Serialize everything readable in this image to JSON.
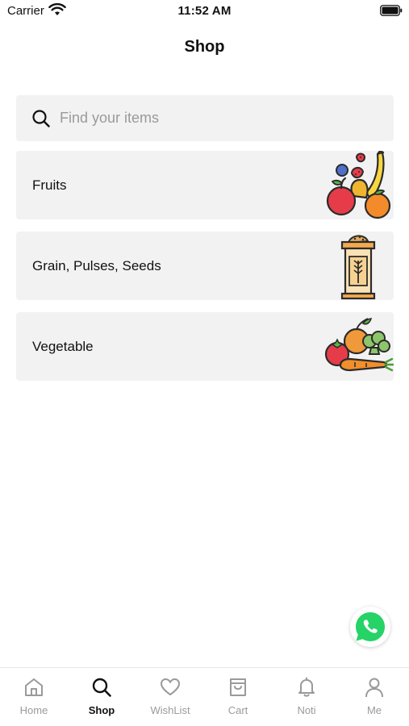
{
  "status_bar": {
    "carrier": "Carrier",
    "time": "11:52 AM"
  },
  "header": {
    "title": "Shop"
  },
  "search": {
    "placeholder": "Find your items"
  },
  "categories": [
    {
      "label": "Fruits",
      "icon": "fruits-illustration"
    },
    {
      "label": "Grain, Pulses, Seeds",
      "icon": "grain-sack-illustration"
    },
    {
      "label": "Vegetable",
      "icon": "vegetables-illustration"
    }
  ],
  "floating_action": {
    "icon": "whatsapp-icon",
    "color": "#25D366"
  },
  "tab_bar": {
    "active": "Shop",
    "items": [
      {
        "label": "Home",
        "icon": "home-icon"
      },
      {
        "label": "Shop",
        "icon": "search-icon"
      },
      {
        "label": "WishList",
        "icon": "heart-icon"
      },
      {
        "label": "Cart",
        "icon": "shopping-bag-icon"
      },
      {
        "label": "Noti",
        "icon": "bell-icon"
      },
      {
        "label": "Me",
        "icon": "user-icon"
      }
    ]
  }
}
